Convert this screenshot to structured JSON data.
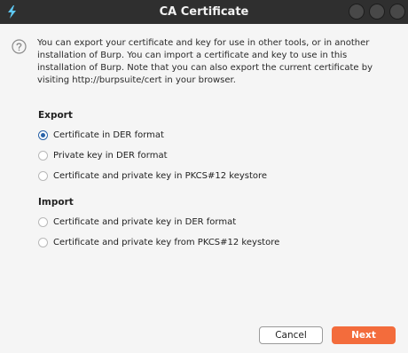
{
  "window": {
    "title": "CA Certificate",
    "app_icon": "burp-lightning-icon"
  },
  "intro": {
    "text": "You can export your certificate and key for use in other tools, or in another installation of Burp. You can import a certificate and key to use in this installation of Burp. Note that you can also export the current certificate by visiting http://burpsuite/cert in your browser."
  },
  "export": {
    "heading": "Export",
    "options": [
      {
        "label": "Certificate in DER format",
        "selected": true
      },
      {
        "label": "Private key in DER format",
        "selected": false
      },
      {
        "label": "Certificate and private key in PKCS#12 keystore",
        "selected": false
      }
    ]
  },
  "import": {
    "heading": "Import",
    "options": [
      {
        "label": "Certificate and private key in DER format",
        "selected": false
      },
      {
        "label": "Certificate and private key from PKCS#12 keystore",
        "selected": false
      }
    ]
  },
  "buttons": {
    "cancel_label": "Cancel",
    "next_label": "Next"
  },
  "colors": {
    "accent": "#f36c3c",
    "titlebar": "#2f2f2f",
    "radio_selected": "#2a63a8"
  }
}
